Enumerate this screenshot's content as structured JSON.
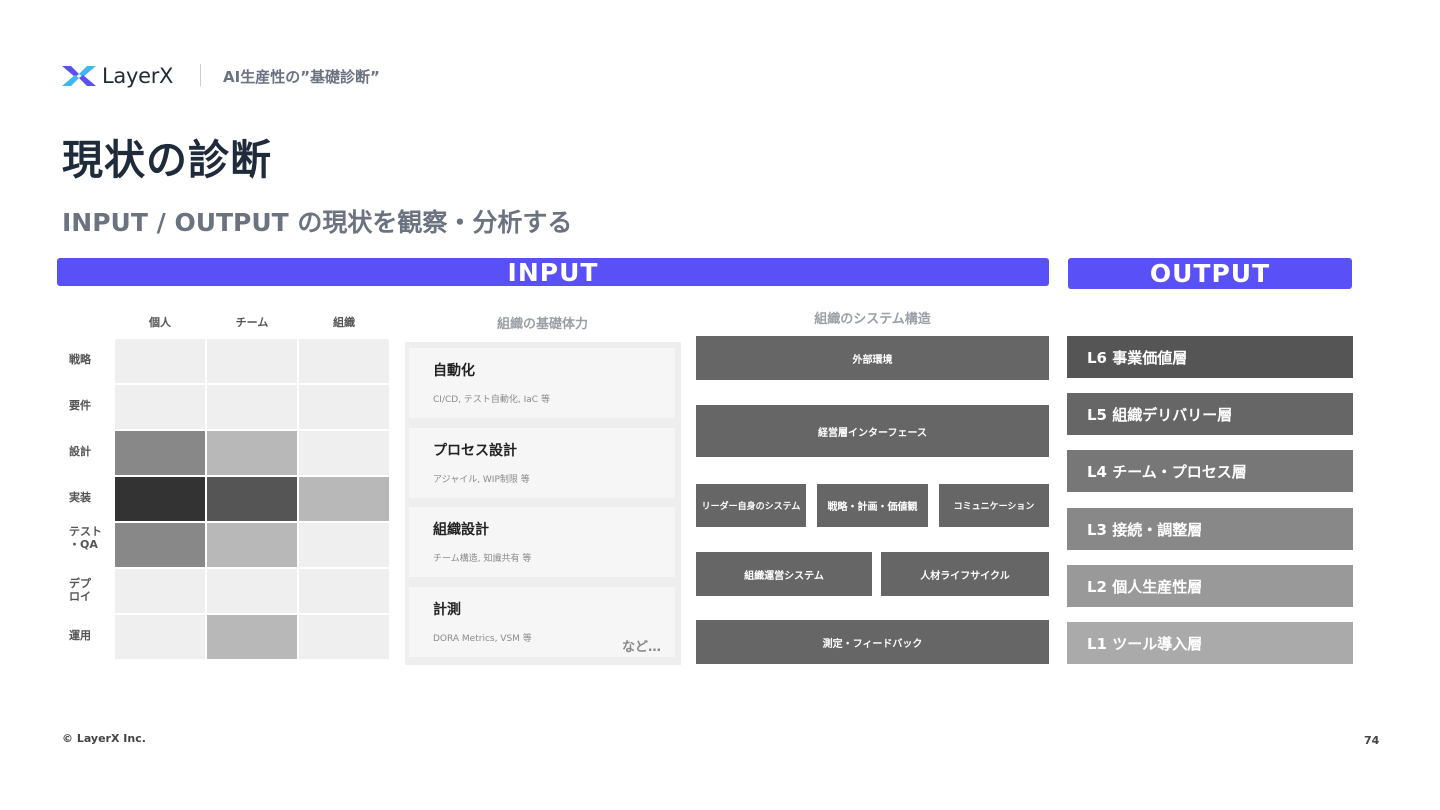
{
  "header": {
    "logo_text": "LayerX",
    "subtitle": "AI生産性の”基礎診断”"
  },
  "title": "現状の診断",
  "subtitle": "INPUT / OUTPUT の現状を観察・分析する",
  "input_banner": "INPUT",
  "output_banner": "OUTPUT",
  "matrix": {
    "columns": [
      "個人",
      "チーム",
      "組織"
    ],
    "rows": [
      {
        "label": "戦略",
        "levels": [
          "empty",
          "empty",
          "empty"
        ]
      },
      {
        "label": "要件",
        "levels": [
          "empty",
          "empty",
          "empty"
        ]
      },
      {
        "label": "設計",
        "levels": [
          "medium",
          "light",
          "empty"
        ]
      },
      {
        "label": "実装",
        "levels": [
          "darkest",
          "dark",
          "light"
        ]
      },
      {
        "label": "テスト\n・QA",
        "levels": [
          "medium",
          "light",
          "empty"
        ]
      },
      {
        "label": "デプロイ",
        "levels": [
          "empty",
          "empty",
          "empty"
        ]
      },
      {
        "label": "運用",
        "levels": [
          "empty",
          "light",
          "empty"
        ]
      }
    ],
    "colors": {
      "empty": "#efefef",
      "light": "#b8b8b8",
      "medium": "#888888",
      "dark": "#555555",
      "darkest": "#333333"
    }
  },
  "basis": {
    "title": "組織の基礎体力",
    "cards": [
      {
        "title": "自動化",
        "desc": "CI/CD, テスト自動化, IaC 等"
      },
      {
        "title": "プロセス設計",
        "desc": "アジャイル, WIP制限 等"
      },
      {
        "title": "組織設計",
        "desc": "チーム構造, 知識共有 等"
      },
      {
        "title": "計測",
        "desc": "DORA Metrics, VSM 等"
      }
    ],
    "etc": "など…"
  },
  "system": {
    "title": "組織のシステム構造",
    "external": "外部環境",
    "management": "経営層インターフェース",
    "leader": "リーダー自身のシステム",
    "strategy": "戦略・計画・価値観",
    "communication": "コミュニケーション",
    "operations": "組織運営システム",
    "talent": "人材ライフサイクル",
    "measurement": "測定・フィードバック"
  },
  "output_layers": [
    {
      "label": "L6 事業価値層",
      "color": "#555555"
    },
    {
      "label": "L5 組織デリバリー層",
      "color": "#666666"
    },
    {
      "label": "L4 チーム・プロセス層",
      "color": "#777777"
    },
    {
      "label": "L3 接続・調整層",
      "color": "#888888"
    },
    {
      "label": "L2 個人生産性層",
      "color": "#999999"
    },
    {
      "label": "L1 ツール導入層",
      "color": "#aaaaaa"
    }
  ],
  "footer": {
    "copyright": "© LayerX Inc.",
    "page_number": "74"
  },
  "brand_color": "#5a50f7"
}
